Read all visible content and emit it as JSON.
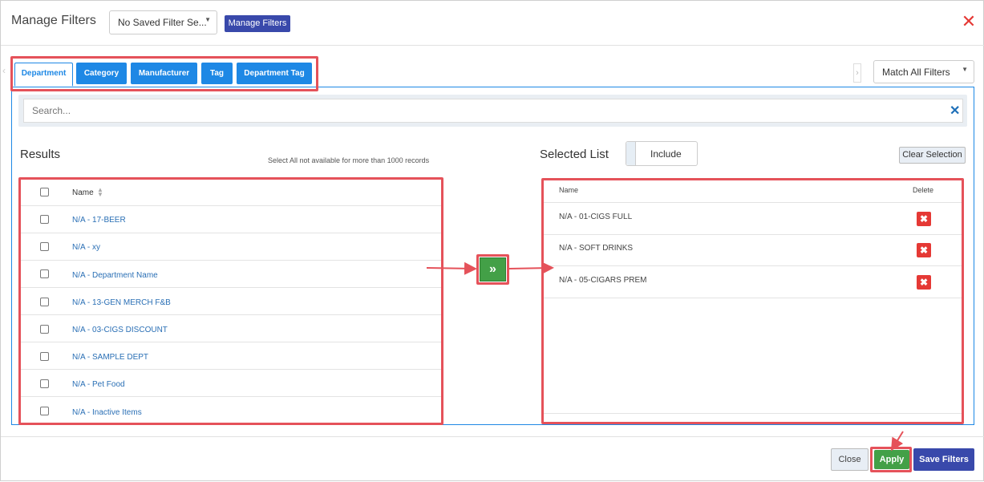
{
  "header": {
    "title": "Manage Filters",
    "saved_filter_select": "No Saved Filter Se...",
    "manage_filters_button": "Manage Filters",
    "close_icon": "close-icon"
  },
  "tabs": [
    {
      "label": "Department",
      "active": true
    },
    {
      "label": "Category",
      "active": false
    },
    {
      "label": "Manufacturer",
      "active": false
    },
    {
      "label": "Tag",
      "active": false
    },
    {
      "label": "Department Tag",
      "active": false
    }
  ],
  "match_select": "Match All Filters",
  "search": {
    "placeholder": "Search..."
  },
  "results": {
    "heading": "Results",
    "note": "Select All not available for more than 1000 records",
    "column_name": "Name",
    "rows": [
      "N/A - 17-BEER",
      "N/A - xy",
      "N/A - Department Name",
      "N/A - 13-GEN MERCH F&B",
      "N/A - 03-CIGS DISCOUNT",
      "N/A - SAMPLE DEPT",
      "N/A - Pet Food",
      "N/A - Inactive Items"
    ]
  },
  "selected": {
    "heading": "Selected List",
    "include_label": "Include",
    "clear_selection": "Clear Selection",
    "column_name": "Name",
    "column_delete": "Delete",
    "rows": [
      "N/A - 01-CIGS FULL",
      "N/A - SOFT DRINKS",
      "N/A - 05-CIGARS PREM"
    ]
  },
  "move_button_icon": "double-chevron-right-icon",
  "footer": {
    "close": "Close",
    "apply": "Apply",
    "save": "Save Filters"
  },
  "colors": {
    "primary_blue": "#1e88e5",
    "indigo": "#3949ab",
    "green": "#43a047",
    "danger_red": "#e53935",
    "annotation_red": "#e5525a"
  }
}
